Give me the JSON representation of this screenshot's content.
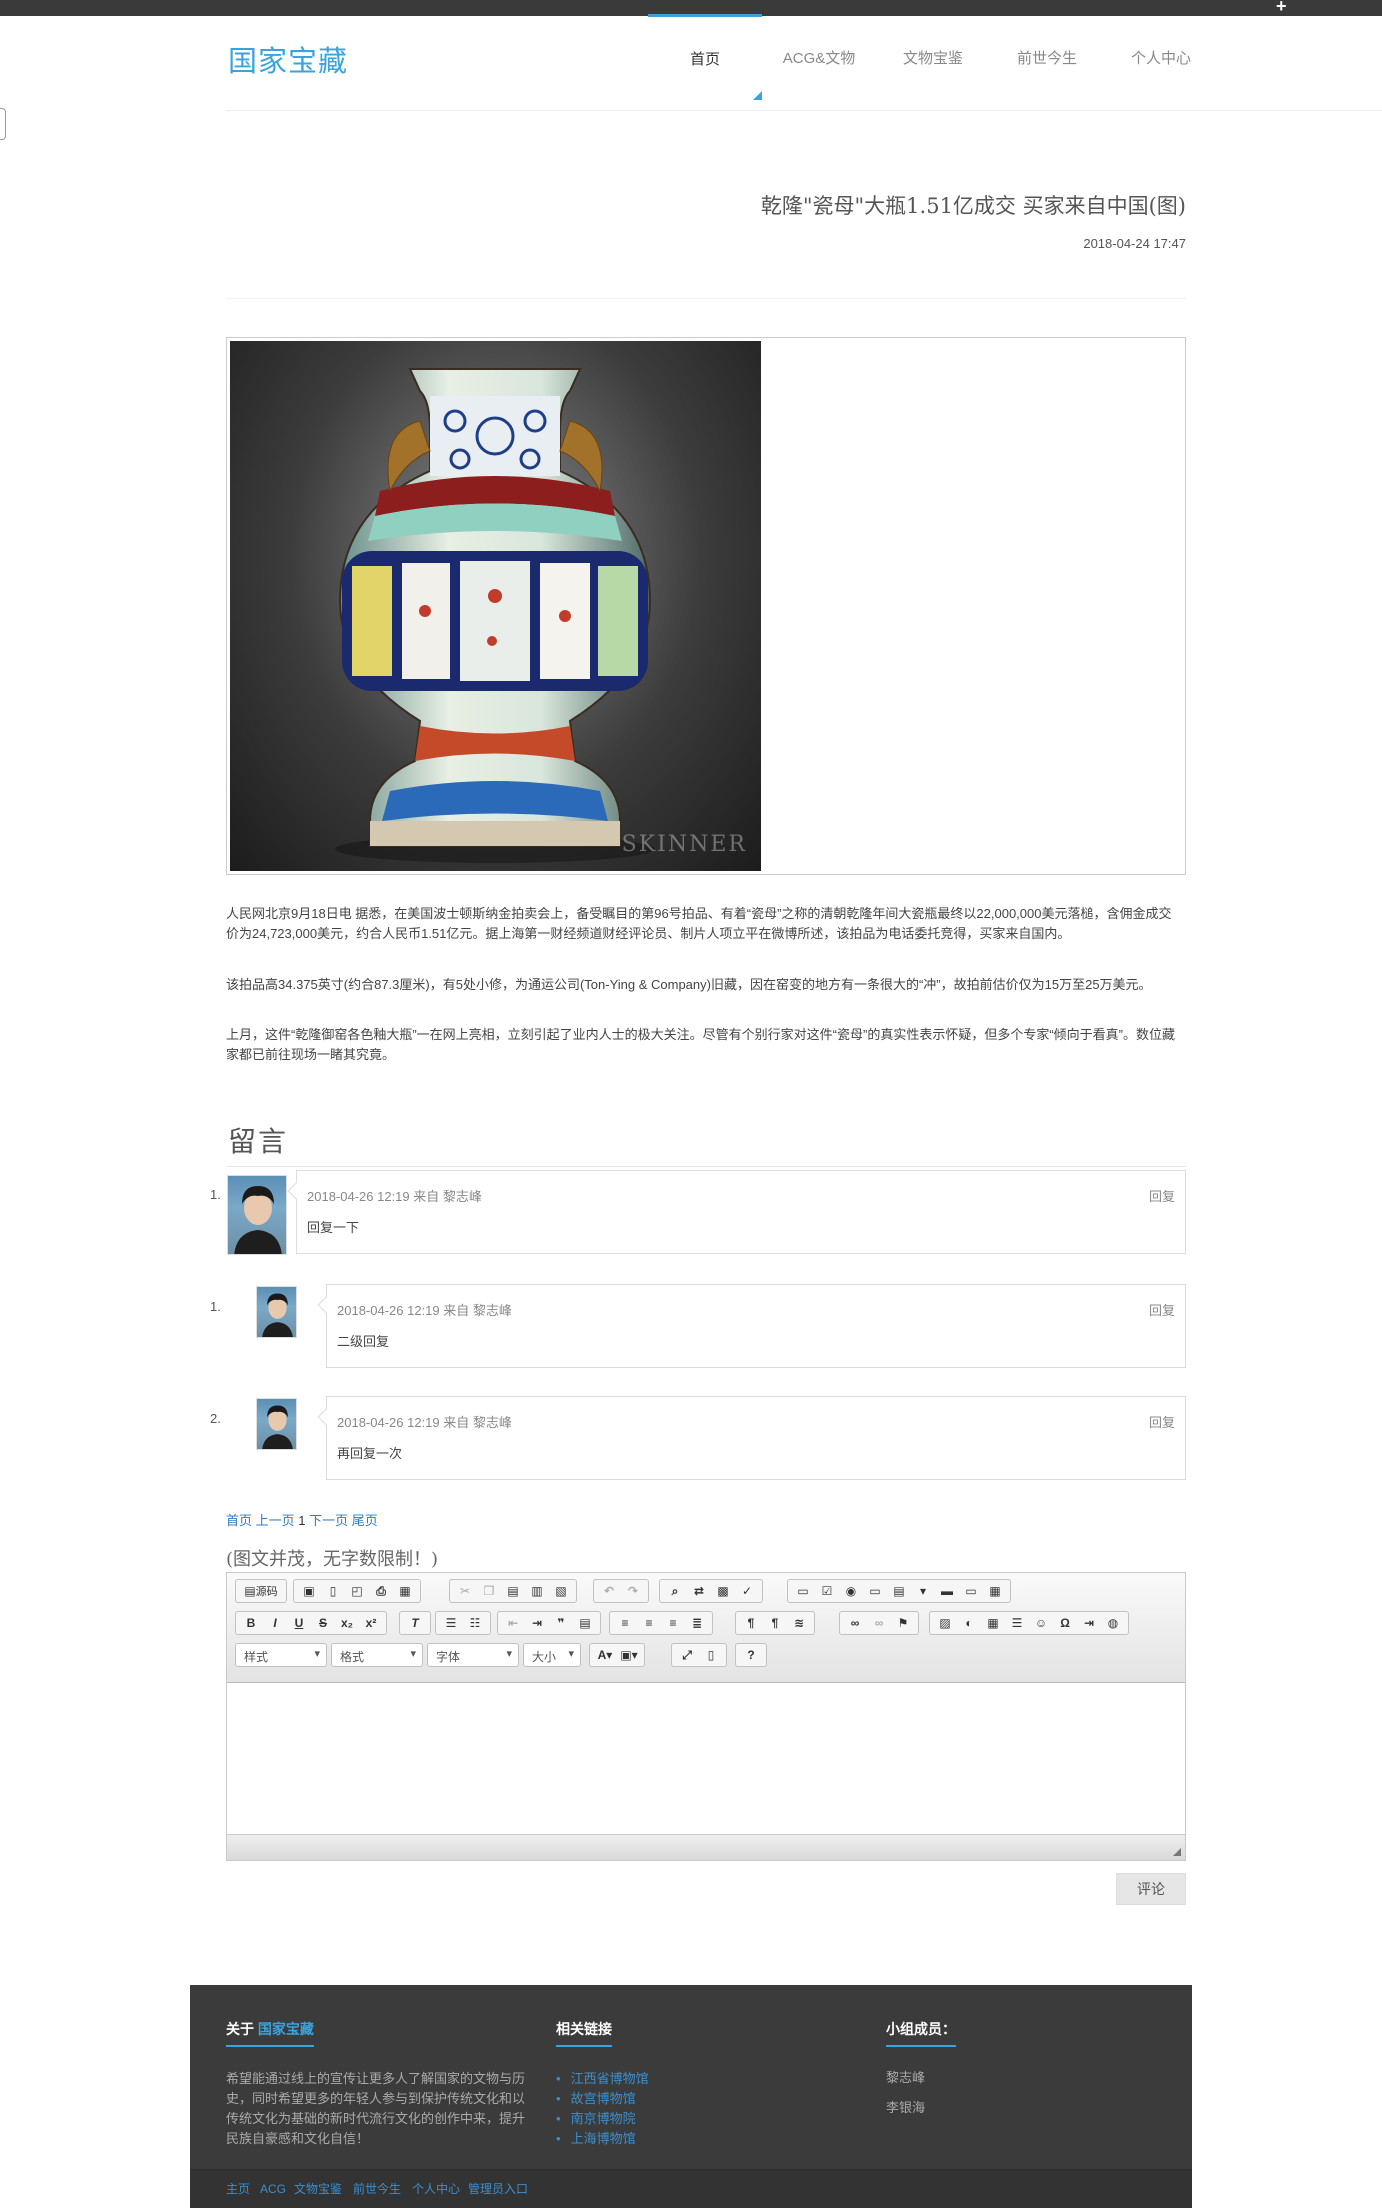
{
  "header": {
    "logo": "国家宝藏",
    "nav": [
      {
        "label": "首页"
      },
      {
        "label": "ACG&文物"
      },
      {
        "label": "文物宝鉴"
      },
      {
        "label": "前世今生"
      },
      {
        "label": "个人中心"
      }
    ]
  },
  "article": {
    "title": "乾隆\"瓷母\"大瓶1.51亿成交 买家来自中国(图)",
    "date": "2018-04-24 17:47",
    "image_watermark": "SKINNER",
    "paragraphs": [
      "人民网北京9月18日电 据悉，在美国波士顿斯纳金拍卖会上，备受瞩目的第96号拍品、有着“瓷母”之称的清朝乾隆年间大瓷瓶最终以22,000,000美元落槌，含佣金成交价为24,723,000美元，约合人民币1.51亿元。据上海第一财经频道财经评论员、制片人项立平在微博所述，该拍品为电话委托竞得，买家来自国内。",
      "该拍品高34.375英寸(约合87.3厘米)，有5处小修，为通运公司(Ton-Ying & Company)旧藏，因在窑变的地方有一条很大的“冲”，故拍前估价仅为15万至25万美元。",
      "上月，这件“乾隆御窑各色釉大瓶”一在网上亮相，立刻引起了业内人士的极大关注。尽管有个别行家对这件“瓷母”的真实性表示怀疑，但多个专家“倾向于看真”。数位藏家都已前往现场一睹其究竟。"
    ]
  },
  "comments": {
    "heading": "留言",
    "items": [
      {
        "num": "1.",
        "meta": "2018-04-26 12:19 来自 黎志峰",
        "reply": "回复",
        "text": "回复一下"
      },
      {
        "num": "1.",
        "meta": "2018-04-26 12:19 来自 黎志峰",
        "reply": "回复",
        "text": "二级回复"
      },
      {
        "num": "2.",
        "meta": "2018-04-26 12:19 来自 黎志峰",
        "reply": "回复",
        "text": "再回复一次"
      }
    ],
    "pager": {
      "first": "首页",
      "prev": "上一页",
      "current": "1",
      "next": "下一页",
      "last": "尾页"
    }
  },
  "editor": {
    "hint": "(图文并茂，无字数限制！)",
    "source_label": "源码",
    "combos": [
      "样式",
      "格式",
      "字体",
      "大小"
    ],
    "submit": "评论"
  },
  "footer": {
    "about_prefix": "关于 ",
    "about_brand": "国家宝藏",
    "about_text": "希望能通过线上的宣传让更多人了解国家的文物与历史，同时希望更多的年轻人参与到保护传统文化和以传统文化为基础的新时代流行文化的创作中来，提升民族自豪感和文化自信！",
    "links_title": "相关链接",
    "links": [
      "江西省博物馆",
      "故宫博物馆",
      "南京博物院",
      "上海博物馆"
    ],
    "members_title": "小组成员：",
    "members": [
      "黎志峰",
      "李银海"
    ],
    "bottom_links": [
      "主页",
      "ACG",
      "文物宝鉴",
      "前世今生",
      "个人中心",
      "管理员入口"
    ]
  },
  "colors": {
    "accent": "#3aa3de",
    "topbar": "#3a3a3a",
    "footer": "#3b3b3b"
  }
}
